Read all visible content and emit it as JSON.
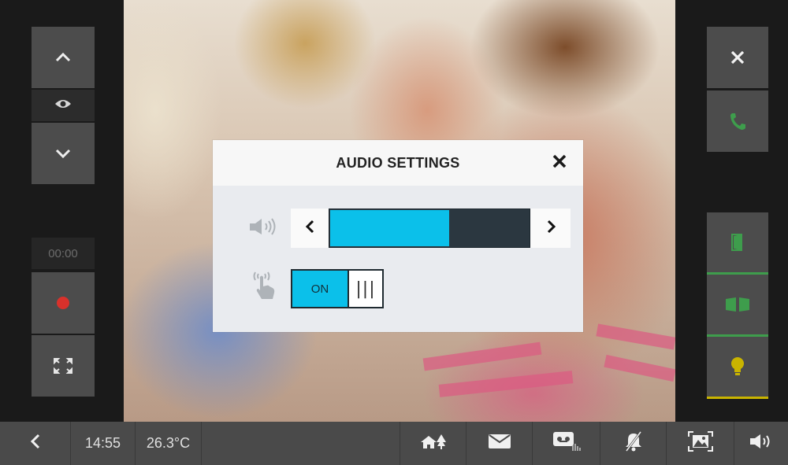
{
  "status_bar": {
    "time": "14:55",
    "temperature": "26.3°C"
  },
  "left_panel": {
    "timer": "00:00",
    "icons": [
      "chevron-up-icon",
      "eye-icon",
      "chevron-down-icon",
      "record-icon",
      "fullscreen-icon"
    ],
    "record_color": "#d9312b"
  },
  "right_panel": {
    "icons": [
      "close-icon",
      "phone-icon",
      "door-icon",
      "gate-icon",
      "light-icon"
    ],
    "accent_green": "#3e9d4c",
    "accent_yellow": "#c9b400"
  },
  "bottom_bar": {
    "icons": [
      "back-icon",
      "home-icon",
      "mail-icon",
      "voicemail-icon",
      "mute-bell-icon",
      "picture-icon",
      "speaker-icon"
    ]
  },
  "dialog": {
    "title": "AUDIO SETTINGS",
    "volume": {
      "level": 0.6,
      "fill_color": "#0bc0ea",
      "track_color": "#2b3740"
    },
    "touch_sound": {
      "state": "ON",
      "knob": "|||"
    }
  }
}
